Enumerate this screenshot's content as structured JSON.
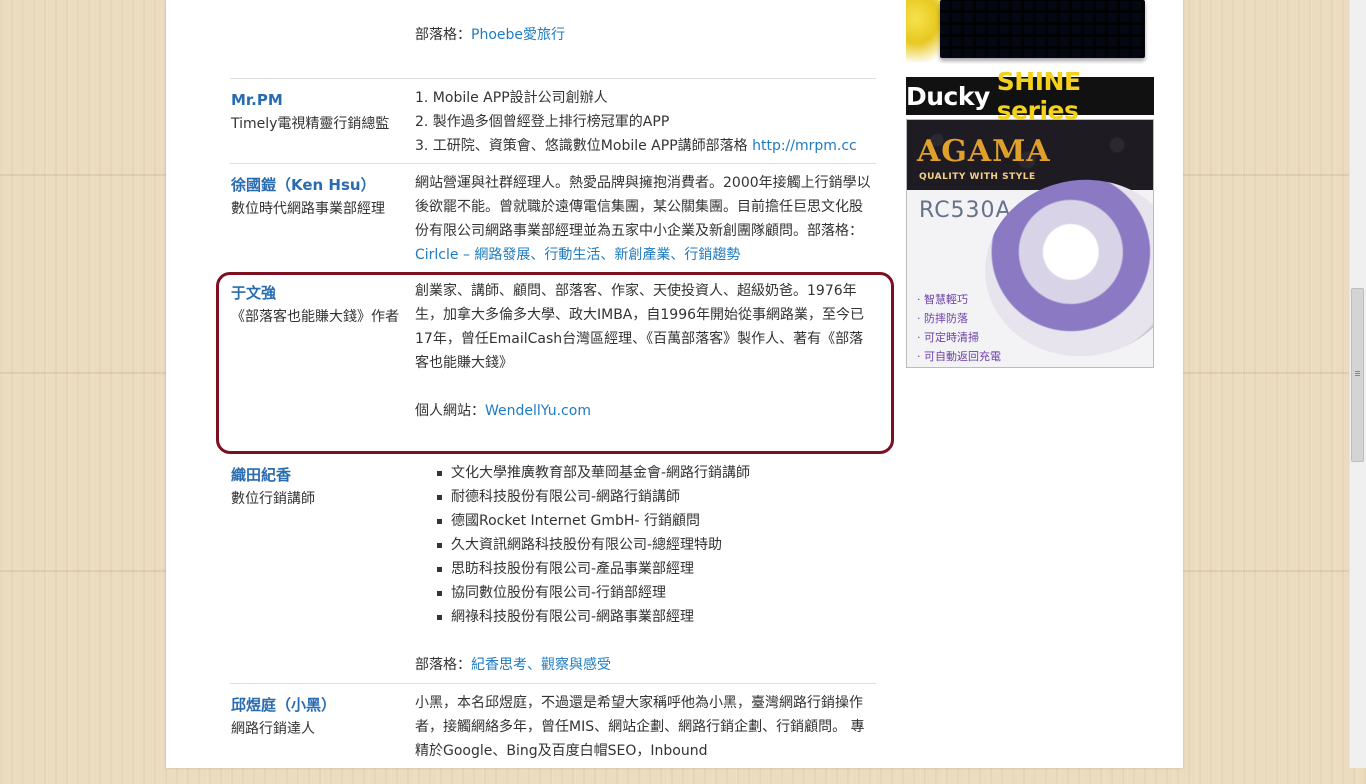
{
  "rows": [
    {
      "blog_label": "部落格：",
      "blog_link": "Phoebe愛旅行"
    },
    {
      "name": "Mr.PM",
      "title": "Timely電視精靈行銷總監",
      "lines": [
        "1. Mobile APP設計公司創辦人",
        "2. 製作過多個曾經登上排行榜冠軍的APP",
        "3. 工研院、資策會、悠識數位Mobile APP講師部落格 "
      ],
      "link": "http://mrpm.cc"
    },
    {
      "name": "徐國鎧（Ken Hsu）",
      "title": "數位時代網路事業部經理",
      "desc": "網站營運與社群經理人。熱愛品牌與擁抱消費者。2000年接觸上行銷學以後欲罷不能。曾就職於遠傳電信集團，某公關集團。目前擔任巨思文化股份有限公司網路事業部經理並為五家中小企業及新創團隊顧問。部落格：",
      "link": "Cirlcle – 網路發展、行動生活、新創產業、行銷趨勢"
    },
    {
      "name": "于文強",
      "title": "《部落客也能賺大錢》作者",
      "desc": "創業家、講師、顧問、部落客、作家、天使投資人、超級奶爸。1976年生，加拿大多倫多大學、政大IMBA，自1996年開始從事網路業，至今已17年，曾任EmailCash台灣區經理、《百萬部落客》製作人、著有《部落客也能賺大錢》",
      "site_label": "個人網站：",
      "site_link": "WendellYu.com"
    },
    {
      "name": "織田紀香",
      "title": "數位行銷講師",
      "items": [
        "文化大學推廣教育部及華岡基金會-網路行銷講師",
        "耐德科技股份有限公司-網路行銷講師",
        "德國Rocket Internet GmbH- 行銷顧問",
        "久大資訊網路科技股份有限公司-總經理特助",
        "思眆科技股份有限公司-產品事業部經理",
        "協同數位股份有限公司-行銷部經理",
        "網祿科技股份有限公司-網路事業部經理"
      ],
      "blog_label": "部落格：",
      "blog_link": "紀香思考、觀察與感受"
    },
    {
      "name": "邱煜庭（小黑）",
      "title": "網路行銷達人",
      "desc": "小黑，本名邱煜庭，不過還是希望大家稱呼他為小黑，臺灣網路行銷操作者，接觸網絡多年，曾任MIS、網站企劃、網路行銷企劃、行銷顧問。 專精於Google、Bing及百度白帽SEO，Inbound"
    }
  ],
  "ads": {
    "ducky_white": "Ducky",
    "ducky_yellow": "SHINE series",
    "agama_logo": "AGAMA",
    "agama_tagline": "QUALITY WITH STYLE",
    "agama_model": "RC530A",
    "agama_features": [
      "· 智慧輕巧",
      "· 防摔防落",
      "· 可定時清掃",
      "· 可自動返回充電"
    ]
  },
  "colors": {
    "link": "#1f7bc1",
    "name": "#2a6cb0",
    "highlight_border": "#7c0f20"
  }
}
